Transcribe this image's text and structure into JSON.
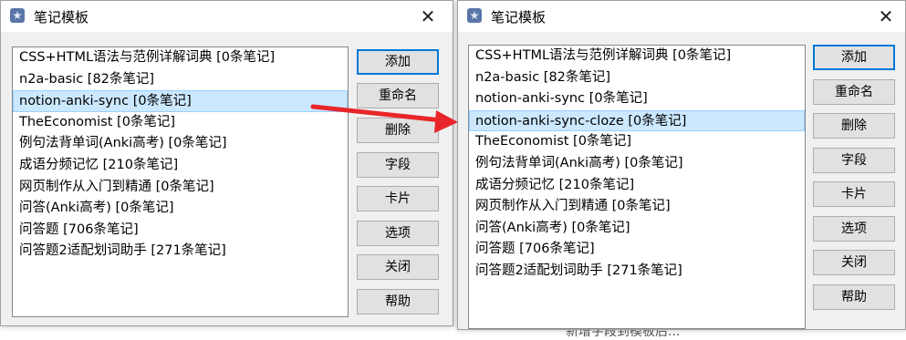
{
  "background": {
    "partial_text": "新增字段到模板后..."
  },
  "dialog_before": {
    "title": "笔记模板",
    "close_label": "✕",
    "items": [
      "CSS+HTML语法与范例详解词典 [0条笔记]",
      "n2a-basic [82条笔记]",
      "notion-anki-sync [0条笔记]",
      "TheEconomist [0条笔记]",
      "例句法背单词(Anki高考) [0条笔记]",
      "成语分频记忆 [210条笔记]",
      "网页制作从入门到精通 [0条笔记]",
      "问答(Anki高考) [0条笔记]",
      "问答题 [706条笔记]",
      "问答题2适配划词助手 [271条笔记]"
    ],
    "selected_index": 2,
    "buttons": [
      "添加",
      "重命名",
      "删除",
      "字段",
      "卡片",
      "选项",
      "关闭",
      "帮助"
    ]
  },
  "dialog_after": {
    "title": "笔记模板",
    "close_label": "✕",
    "items": [
      "CSS+HTML语法与范例详解词典 [0条笔记]",
      "n2a-basic [82条笔记]",
      "notion-anki-sync [0条笔记]",
      "notion-anki-sync-cloze [0条笔记]",
      "TheEconomist [0条笔记]",
      "例句法背单词(Anki高考) [0条笔记]",
      "成语分频记忆 [210条笔记]",
      "网页制作从入门到精通 [0条笔记]",
      "问答(Anki高考) [0条笔记]",
      "问答题 [706条笔记]",
      "问答题2适配划词助手 [271条笔记]"
    ],
    "selected_index": 3,
    "buttons": [
      "添加",
      "重命名",
      "删除",
      "字段",
      "卡片",
      "选项",
      "关闭",
      "帮助"
    ]
  },
  "colors": {
    "arrow": "#e8262a",
    "selection": "#cce8ff",
    "default_button_border": "#0078d7"
  },
  "icons": {
    "app": "anki-star-icon",
    "close": "close-icon",
    "arrow": "red-arrow"
  }
}
